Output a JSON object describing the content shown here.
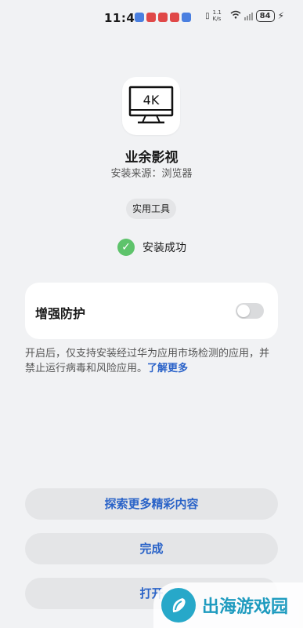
{
  "status_bar": {
    "time": "11:49",
    "network_speed": "1.1 K/s",
    "battery": "84",
    "notification_colors": [
      "#4a7fe0",
      "#e04848",
      "#e04848",
      "#e04848",
      "#4a7fe0"
    ]
  },
  "app": {
    "icon": "tv-4k-icon",
    "icon_text": "4K",
    "name": "业余影视",
    "source": "安装来源：浏览器",
    "category_tag": "实用工具",
    "install_status": "安装成功"
  },
  "protection": {
    "title": "增强防护",
    "enabled": false,
    "description": "开启后，仅支持安装经过华为应用市场检测的应用，并禁止运行病毒和风险应用。",
    "learn_more": "了解更多"
  },
  "buttons": {
    "explore": "探索更多精彩内容",
    "done": "完成",
    "open": "打开"
  },
  "watermark": {
    "text": "出海游戏园"
  },
  "colors": {
    "accent": "#2a63c8",
    "success": "#5ec36b",
    "background": "#f1f2f4"
  }
}
